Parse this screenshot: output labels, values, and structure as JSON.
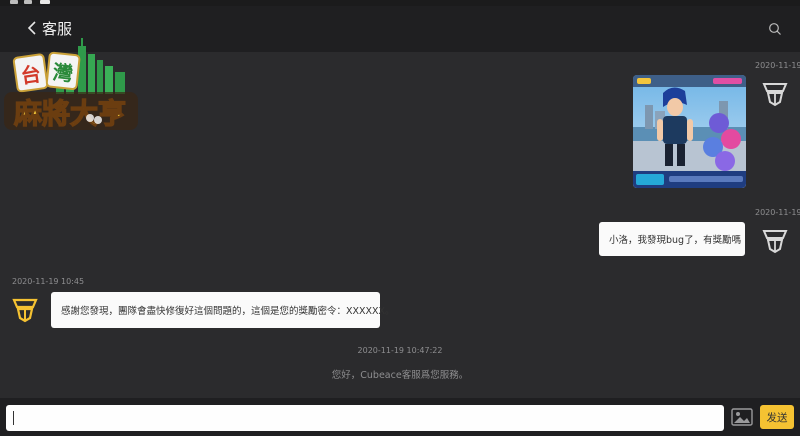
{
  "header": {
    "title": "客服"
  },
  "logo": {
    "brand_text": "台灣麻將大亨"
  },
  "messages": [
    {
      "side": "right",
      "type": "image",
      "timestamp": "2020-11-19"
    },
    {
      "side": "right",
      "type": "text",
      "timestamp": "2020-11-19",
      "text": "小洛，我發現bug了，有獎勵嗎"
    },
    {
      "side": "left",
      "type": "text",
      "timestamp": "2020-11-19 10:45",
      "text": "感謝您發現，團隊會盡快修復好這個問題的，這個是您的獎勵密令：XXXXXX。"
    }
  ],
  "system": {
    "timestamp": "2020-11-19 10:47:22",
    "text": "您好，Cubeace客服爲您服務。"
  },
  "input": {
    "value": "",
    "send_label": "发送"
  },
  "colors": {
    "background": "#2b2b2d",
    "header": "#1f1f21",
    "accent": "#f5c232"
  }
}
